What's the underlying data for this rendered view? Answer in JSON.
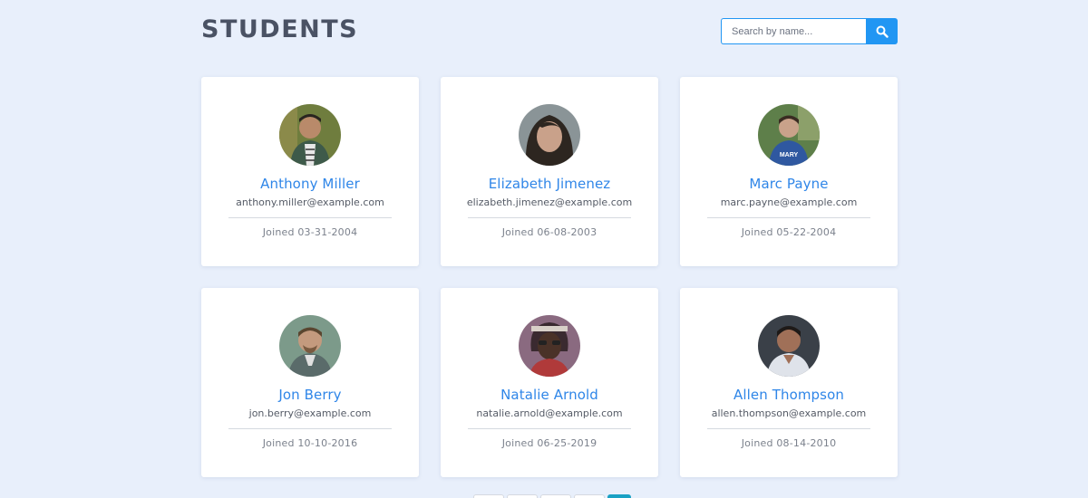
{
  "header": {
    "title": "STUDENTS",
    "search": {
      "placeholder": "Search by name...",
      "value": ""
    }
  },
  "students": [
    {
      "name": "Anthony Miller",
      "email": "anthony.miller@example.com",
      "joined": "Joined 03-31-2004"
    },
    {
      "name": "Elizabeth Jimenez",
      "email": "elizabeth.jimenez@example.com",
      "joined": "Joined 06-08-2003"
    },
    {
      "name": "Marc Payne",
      "email": "marc.payne@example.com",
      "joined": "Joined 05-22-2004"
    },
    {
      "name": "Jon Berry",
      "email": "jon.berry@example.com",
      "joined": "Joined 10-10-2016"
    },
    {
      "name": "Natalie Arnold",
      "email": "natalie.arnold@example.com",
      "joined": "Joined 06-25-2019"
    },
    {
      "name": "Allen Thompson",
      "email": "allen.thompson@example.com",
      "joined": "Joined 08-14-2010"
    }
  ],
  "colors": {
    "background": "#e8effb",
    "accent": "#2196f3",
    "name_link": "#2f86e8",
    "title": "#4a5264"
  },
  "icons": {
    "search_button": "search-icon"
  }
}
